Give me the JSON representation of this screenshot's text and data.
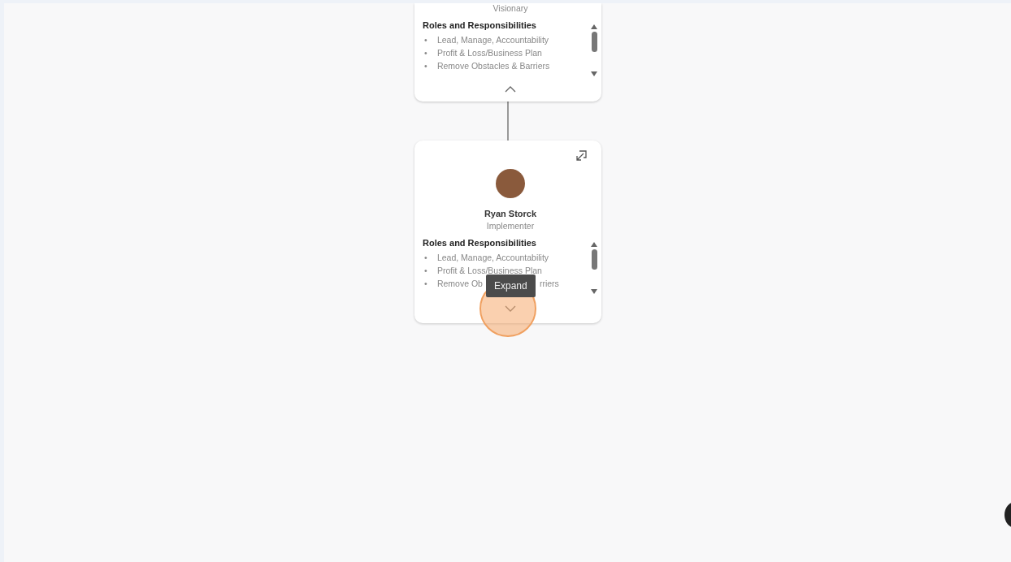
{
  "cards": [
    {
      "subtitle": "Visionary",
      "heading": "Roles and Responsibilities",
      "expanded": true,
      "items": [
        {
          "kind": "full",
          "marker": "•",
          "text": "Lead, Manage, Accountability"
        },
        {
          "kind": "full",
          "marker": "•",
          "text": "Profit & Loss/Business Plan"
        },
        {
          "kind": "full",
          "marker": "•",
          "text": "Remove Obstacles & Barriers"
        }
      ]
    },
    {
      "name": "Ryan Storck",
      "subtitle": "Implementer",
      "heading": "Roles and Responsibilities",
      "expanded": false,
      "items": [
        {
          "kind": "full",
          "marker": "•",
          "text": "Lead, Manage, Accountability"
        },
        {
          "kind": "full",
          "marker": "•",
          "text": "Profit & Loss/Business Plan"
        },
        {
          "kind": "covered",
          "marker": "•",
          "start": "Remove Ob",
          "end": "rriers"
        }
      ]
    }
  ],
  "tooltip": {
    "text": "Expand"
  }
}
